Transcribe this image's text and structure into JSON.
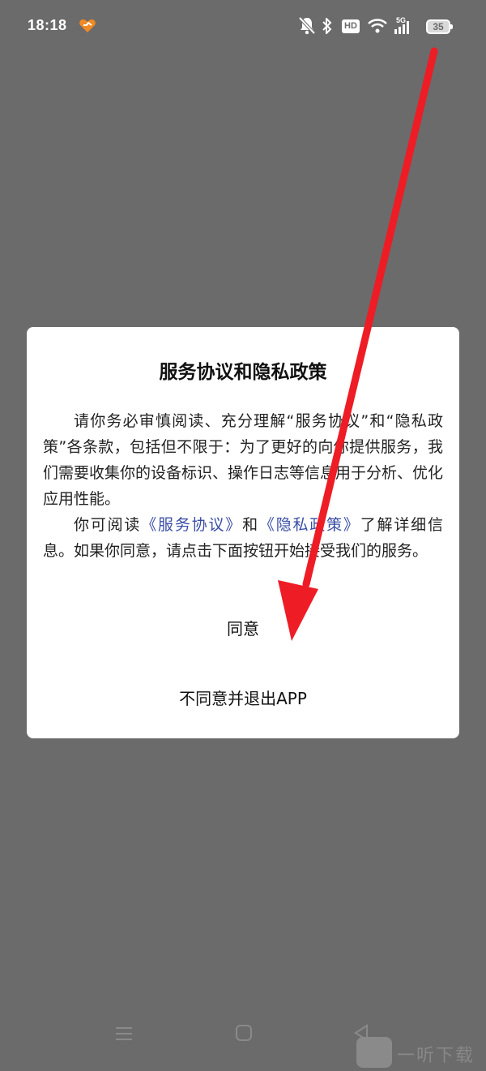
{
  "status_bar": {
    "time": "18:18",
    "network_type": "5G",
    "hd_label": "HD",
    "battery_level": "35",
    "icons": [
      "app-notification-icon",
      "mute-bell-icon",
      "bluetooth-icon",
      "hd-icon",
      "wifi-icon",
      "signal-icon",
      "battery-icon"
    ]
  },
  "dialog": {
    "title": "服务协议和隐私政策",
    "paragraph1": "请你务必审慎阅读、充分理解“服务协议”和“隐私政策”各条款，包括但不限于：为了更好的向你提供服务，我们需要收集你的设备标识、操作日志等信息用于分析、优化应用性能。",
    "paragraph2_prefix": "你可阅读",
    "service_link": "《服务协议》",
    "paragraph2_and": "和",
    "privacy_link": "《隐私政策》",
    "paragraph2_suffix": "了解详细信息。如果你同意，请点击下面按钮开始接受我们的服务。",
    "agree_label": "同意",
    "disagree_label": "不同意并退出APP"
  },
  "nav_bar": {
    "icons": [
      "menu-icon",
      "home-icon",
      "back-icon"
    ]
  },
  "watermark": {
    "text": "一听下载"
  },
  "colors": {
    "backdrop": "#6b6b6b",
    "dialog_bg": "#ffffff",
    "link": "#3a4ea6",
    "arrow": "#ee1c25",
    "app_icon": "#f08a24"
  }
}
